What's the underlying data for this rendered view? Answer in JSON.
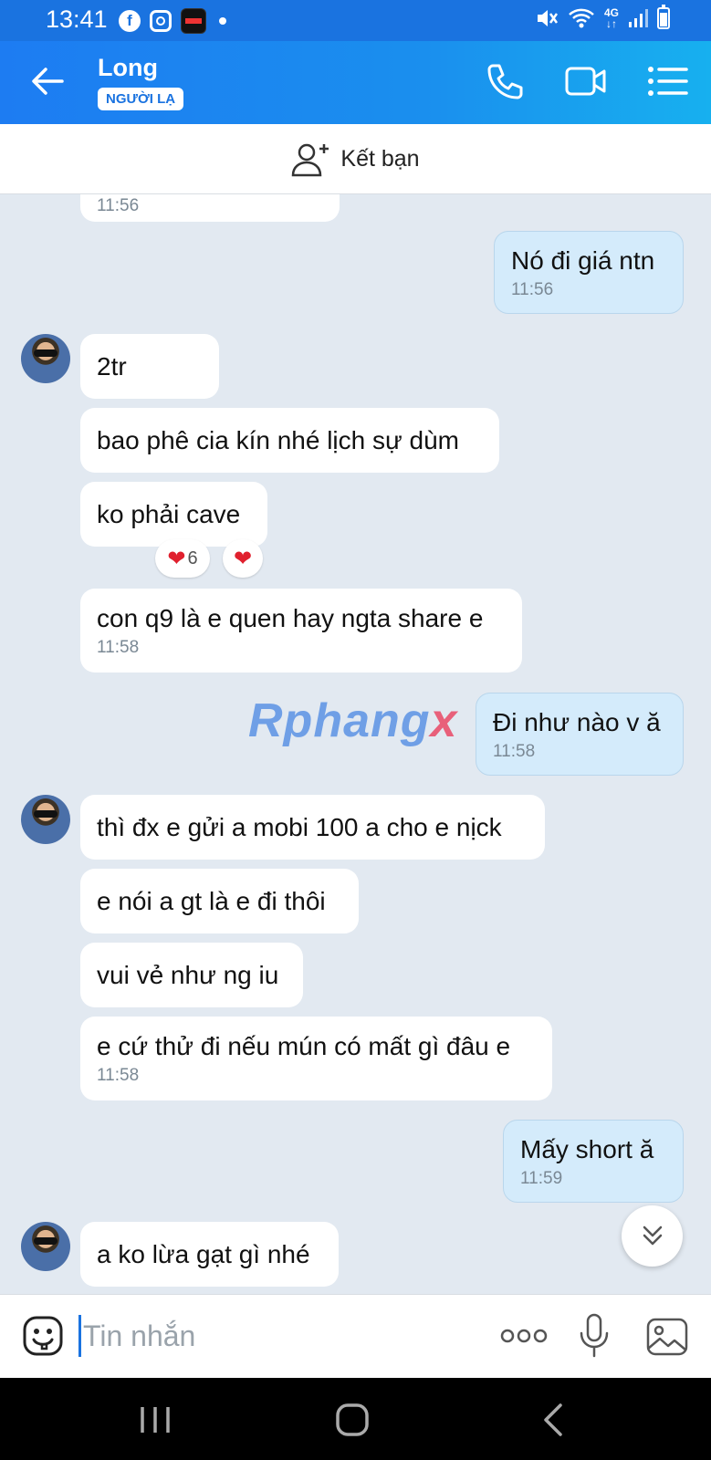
{
  "status_bar": {
    "time": "13:41",
    "network": "4G"
  },
  "header": {
    "contact_name": "Long",
    "badge": "NGƯỜI LẠ"
  },
  "add_friend": {
    "label": "Kết bạn"
  },
  "chat": {
    "partial_top_time": "11:56",
    "messages": [
      {
        "text": "Nó đi giá ntn",
        "time": "11:56"
      },
      {
        "text": "2tr"
      },
      {
        "text": "bao phê cia kín nhé lịch sự dùm"
      },
      {
        "text": "ko phải cave",
        "reaction_count": "6"
      },
      {
        "text": "con q9 là e quen hay ngta share e",
        "time": "11:58"
      },
      {
        "text": "Đi như nào v ă",
        "time": "11:58"
      },
      {
        "text": "thì đx e gửi a mobi 100 a cho e nịck"
      },
      {
        "text": "e nói a gt là e đi thôi"
      },
      {
        "text": "vui vẻ như ng iu"
      },
      {
        "text": "e cứ thử đi nếu mún có mất gì đâu e",
        "time": "11:58"
      },
      {
        "text": "Mấy short ă",
        "time": "11:59"
      },
      {
        "text": "a ko lừa gạt gì nhé"
      }
    ],
    "watermark_main": "Rphang",
    "watermark_x": "x"
  },
  "input": {
    "placeholder": "Tin nhắn"
  },
  "colors": {
    "header": "#1d7cf2",
    "incoming": "#ffffff",
    "outgoing": "#d4ebfb",
    "background": "#e2e9f1"
  },
  "icons": [
    "back-arrow-icon",
    "phone-icon",
    "video-call-icon",
    "menu-list-icon",
    "add-friend-icon",
    "emoji-icon",
    "more-icon",
    "microphone-icon",
    "image-icon",
    "chevron-double-down-icon"
  ]
}
